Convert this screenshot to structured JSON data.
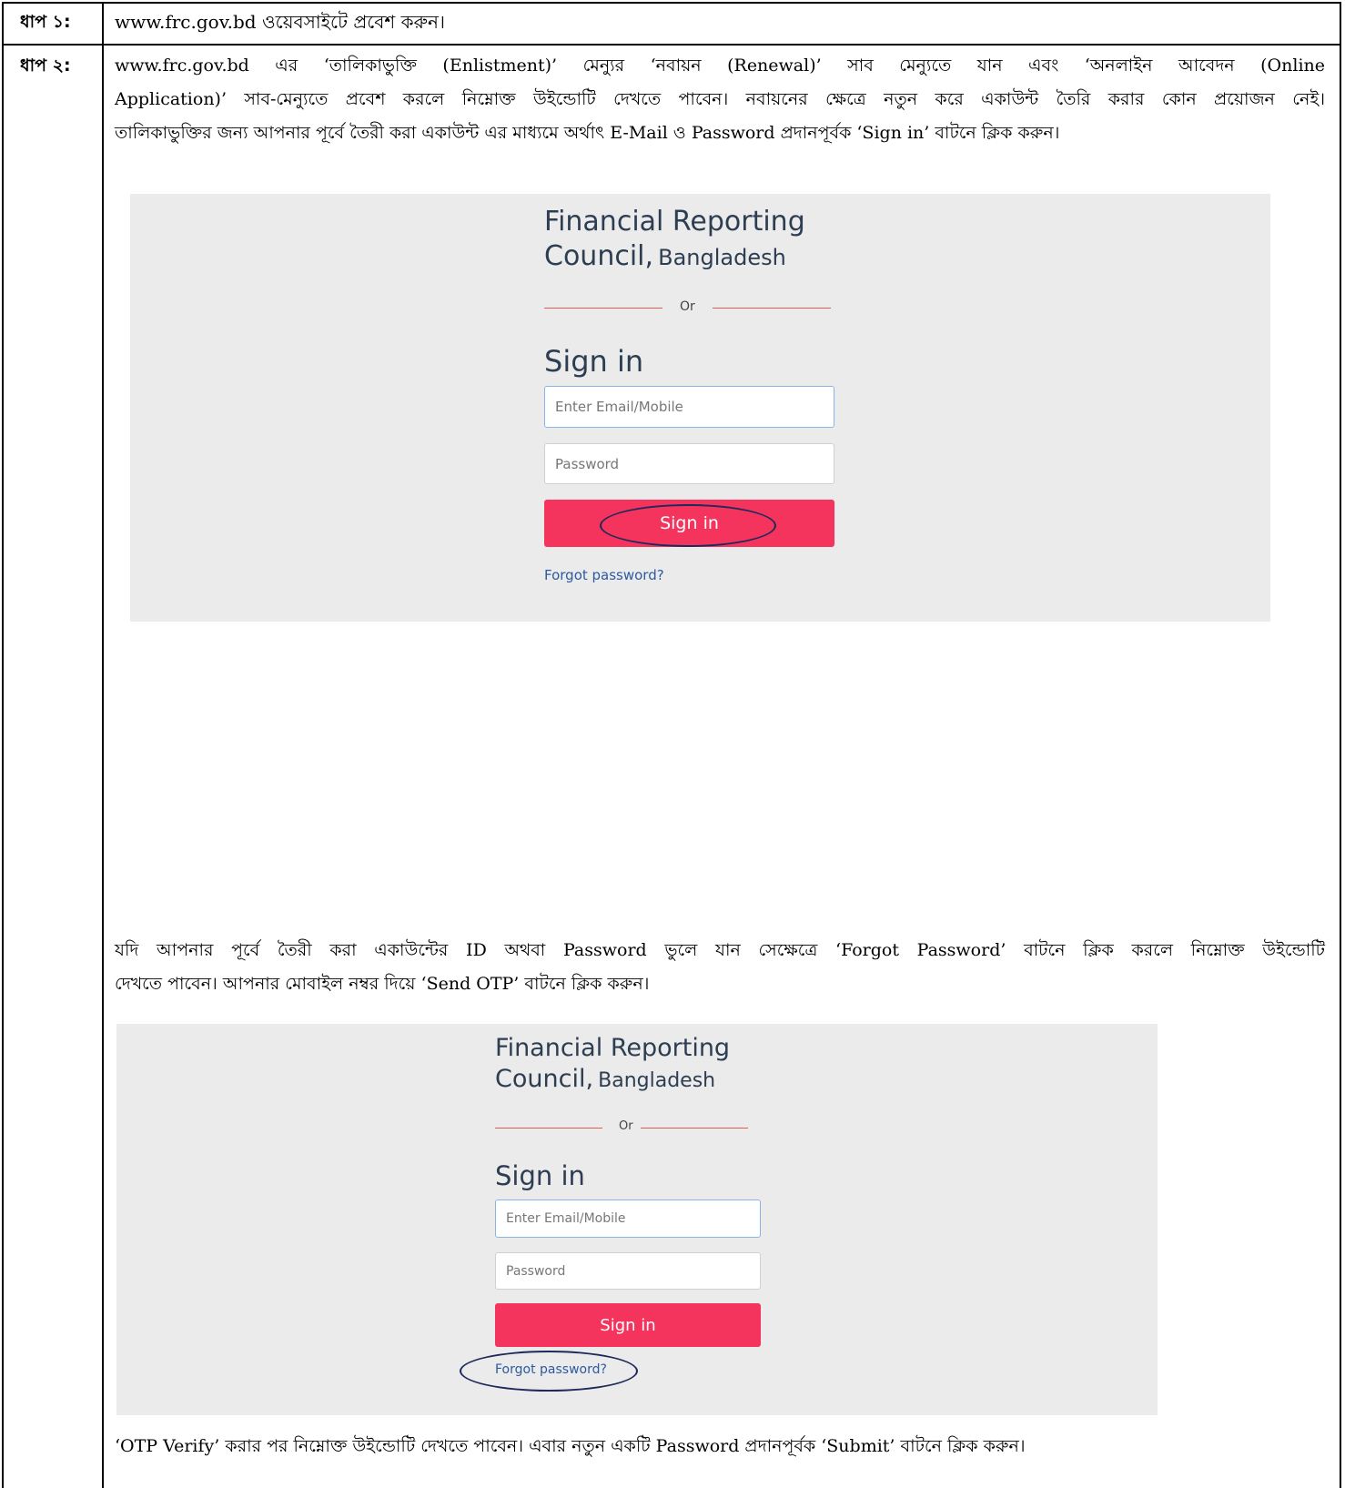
{
  "steps": [
    {
      "label": "ধাপ ১:",
      "text": "www.frc.gov.bd ওয়েবসাইটে প্রবেশ করুন।"
    },
    {
      "label": "ধাপ ২:",
      "lines": [
        "www.frc.gov.bd এর ‘তালিকাভুক্তি (Enlistment)’ মেন্যুর ‘নবায়ন (Renewal)’ সাব মেন্যুতে যান এবং ‘অনলাইন আবেদন (Online",
        "Application)’ সাব-মেন্যুতে প্রবেশ করলে নিম্নোক্ত উইন্ডোটি দেখতে পাবেন। নবায়নের ক্ষেত্রে নতুন করে একাউন্ট তৈরি করার কোন প্রয়োজন নেই।",
        "তালিকাভুক্তির জন্য আপনার পূর্বে তৈরী করা একাউন্ট এর মাধ্যমে অর্থাৎ E-Mail ও Password প্রদানপূর্বক ‘Sign in’ বাটনে ক্লিক করুন।"
      ]
    }
  ],
  "forgot_para": [
    "যদি আপনার পূর্বে তৈরী করা একাউন্টের ID অথবা Password ভুলে যান সেক্ষেত্রে ‘Forgot Password’ বাটনে ক্লিক করলে নিম্নোক্ত উইন্ডোটি",
    "দেখতে পাবেন। আপনার মোবাইল নম্বর দিয়ে ‘Send OTP’ বাটনে ক্লিক করুন।"
  ],
  "otp_para": "‘OTP Verify’ করার পর নিম্নোক্ত উইন্ডোটি দেখতে পাবেন। এবার নতুন একটি Password প্রদানপূর্বক ‘Submit’ বাটনে ক্লিক করুন।",
  "login_window": {
    "brand_line1": "Financial Reporting",
    "brand_line2a": "Council,",
    "brand_line2b": "Bangladesh",
    "or": "Or",
    "heading": "Sign in",
    "email_placeholder": "Enter Email/Mobile",
    "password_placeholder": "Password",
    "signin_button": "Sign in",
    "forgot_link": "Forgot password?"
  },
  "colors": {
    "button": "#f4345d",
    "panel": "#ebebeb",
    "brand_text": "#2e3e52",
    "link": "#2c5aa0",
    "highlight_ellipse": "#1f2a5c",
    "divider": "#e05a5a"
  }
}
